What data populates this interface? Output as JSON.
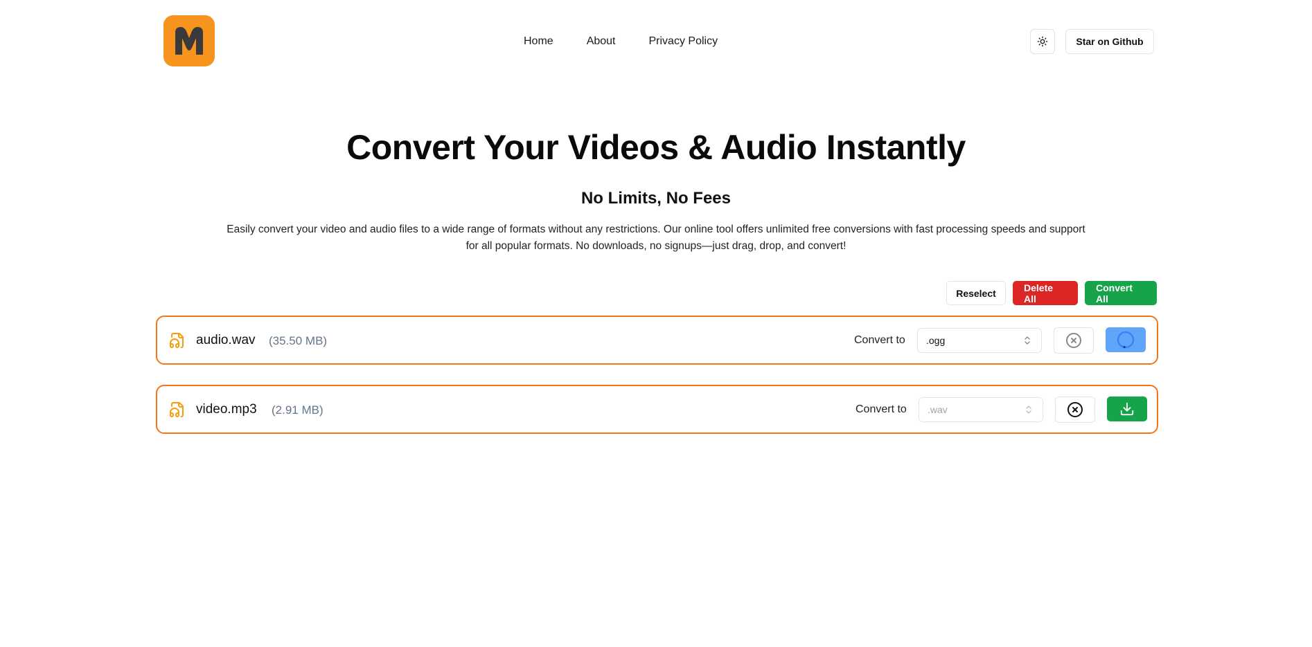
{
  "header": {
    "logo_letter": "M",
    "nav": [
      "Home",
      "About",
      "Privacy Policy"
    ],
    "theme_icon": "sun-icon",
    "github_label": "Star on Github"
  },
  "hero": {
    "title": "Convert Your Videos & Audio Instantly",
    "subtitle": "No Limits, No Fees",
    "description": "Easily convert your video and audio files to a wide range of formats without any restrictions. Our online tool offers unlimited free conversions with fast processing speeds and support for all popular formats. No downloads, no signups—just drag, drop, and convert!"
  },
  "actions": {
    "reselect": "Reselect",
    "delete_all": "Delete All",
    "convert_all": "Convert All"
  },
  "files": [
    {
      "name": "audio.wav",
      "size": "(35.50 MB)",
      "convert_label": "Convert to",
      "format": ".ogg",
      "status": "converting"
    },
    {
      "name": "video.mp3",
      "size": "(2.91 MB)",
      "convert_label": "Convert to",
      "format": ".wav",
      "status": "done"
    }
  ],
  "colors": {
    "accent_orange": "#f97316",
    "logo_orange": "#f7941d",
    "danger": "#dc2626",
    "success": "#16a34a",
    "loading_blue": "#60a5fa"
  }
}
